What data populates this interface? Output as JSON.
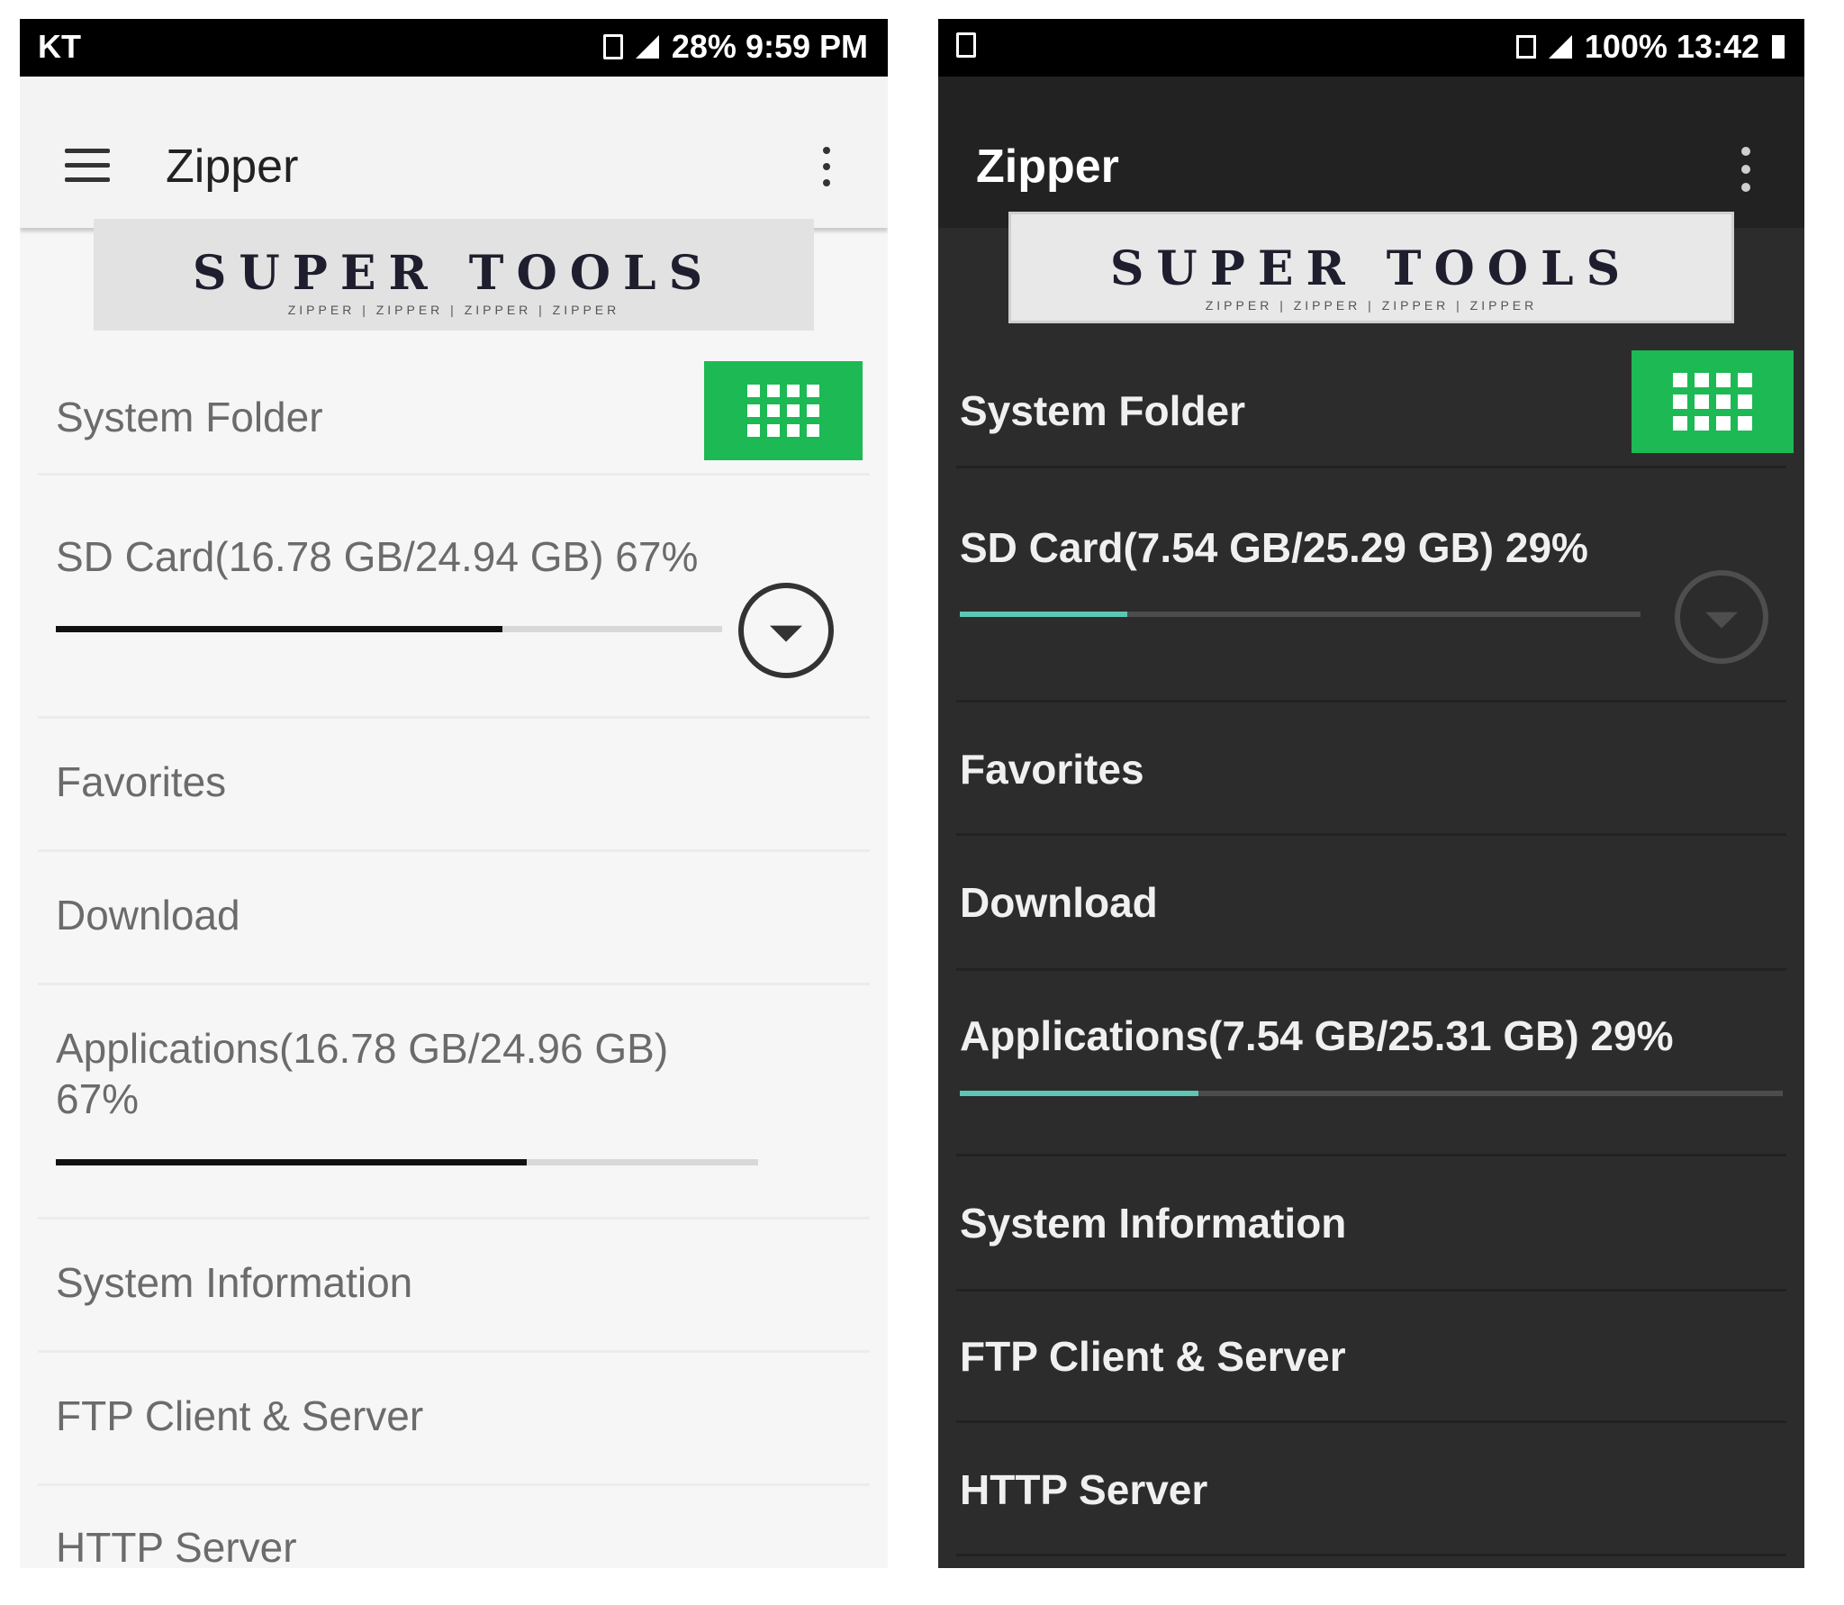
{
  "light": {
    "status": {
      "carrier": "KT",
      "right": "28%  9:59 PM"
    },
    "app_title": "Zipper",
    "banner": {
      "title": "SUPER TOOLS",
      "subtitle": "ZIPPER | ZIPPER | ZIPPER | ZIPPER"
    },
    "items": {
      "system_folder": "System Folder",
      "sd_card": "SD Card(16.78 GB/24.94 GB) 67%",
      "favorites": "Favorites",
      "download": "Download",
      "applications_line1": "Applications(16.78 GB/24.96 GB)",
      "applications_line2": "67%",
      "system_information": "System Information",
      "ftp": "FTP Client & Server",
      "http": "HTTP Server"
    },
    "progress": {
      "sd_card": 0.67,
      "applications": 0.67
    },
    "colors": {
      "bar_fill": "#111111",
      "grid_button": "#1db954"
    }
  },
  "dark": {
    "status": {
      "right": "100%  13:42"
    },
    "app_title": "Zipper",
    "banner": {
      "title": "SUPER TOOLS",
      "subtitle": "ZIPPER | ZIPPER | ZIPPER | ZIPPER"
    },
    "items": {
      "system_folder": "System Folder",
      "sd_card": "SD Card(7.54 GB/25.29 GB) 29%",
      "favorites": "Favorites",
      "download": "Download",
      "applications": "Applications(7.54 GB/25.31 GB) 29%",
      "system_information": "System Information",
      "ftp": "FTP Client & Server",
      "http": "HTTP Server"
    },
    "progress": {
      "sd_card": 0.29,
      "applications": 0.29
    },
    "colors": {
      "bar_fill": "#5cc7b4",
      "grid_button": "#1db954"
    }
  },
  "icons": [
    "menu-icon",
    "overflow-menu-icon",
    "grid-icon",
    "dropdown-icon",
    "signal-icon",
    "battery-icon"
  ]
}
